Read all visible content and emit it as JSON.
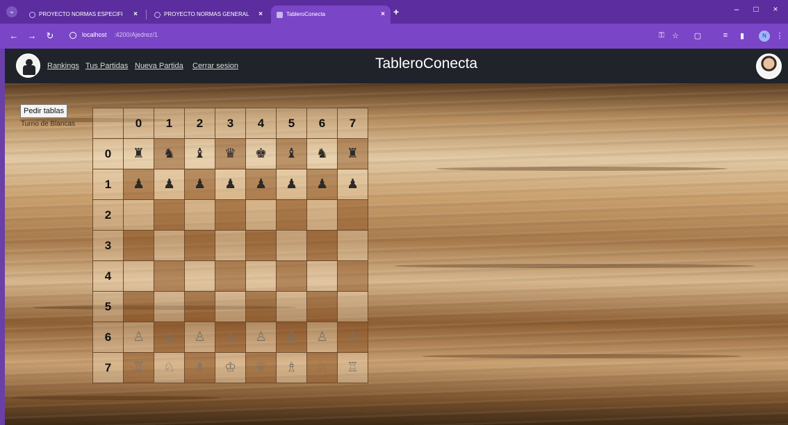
{
  "browser": {
    "tabs": [
      {
        "title": "PROYECTO NORMAS ESPECIFI",
        "active": false
      },
      {
        "title": "PROYECTO NORMAS GENERAL",
        "active": false
      },
      {
        "title": "TableroConecta",
        "active": true
      }
    ],
    "url_host": "localhost",
    "url_path": ":4200/Ajedrez/1",
    "accent_color": "#7b45c7"
  },
  "header": {
    "nav": [
      "Rankings",
      "Tus Partidas",
      "Nueva Partida",
      "Cerrar sesion"
    ],
    "brand": "TableroConecta",
    "background": "#21232a"
  },
  "game": {
    "request_button": "Pedir tablas",
    "turn": "Turno de Blancas",
    "columns": [
      "0",
      "1",
      "2",
      "3",
      "4",
      "5",
      "6",
      "7"
    ],
    "rows": [
      "0",
      "1",
      "2",
      "3",
      "4",
      "5",
      "6",
      "7"
    ],
    "pieces": [
      [
        [
          "black",
          "rook"
        ],
        [
          "black",
          "knight"
        ],
        [
          "black",
          "bishop"
        ],
        [
          "black",
          "queen"
        ],
        [
          "black",
          "king"
        ],
        [
          "black",
          "bishop"
        ],
        [
          "black",
          "knight"
        ],
        [
          "black",
          "rook"
        ]
      ],
      [
        [
          "black",
          "pawn"
        ],
        [
          "black",
          "pawn"
        ],
        [
          "black",
          "pawn"
        ],
        [
          "black",
          "pawn"
        ],
        [
          "black",
          "pawn"
        ],
        [
          "black",
          "pawn"
        ],
        [
          "black",
          "pawn"
        ],
        [
          "black",
          "pawn"
        ]
      ],
      [
        null,
        null,
        null,
        null,
        null,
        null,
        null,
        null
      ],
      [
        null,
        null,
        null,
        null,
        null,
        null,
        null,
        null
      ],
      [
        null,
        null,
        null,
        null,
        null,
        null,
        null,
        null
      ],
      [
        null,
        null,
        null,
        null,
        null,
        null,
        null,
        null
      ],
      [
        [
          "white",
          "pawn"
        ],
        [
          "white",
          "pawn"
        ],
        [
          "white",
          "pawn"
        ],
        [
          "white",
          "pawn"
        ],
        [
          "white",
          "pawn"
        ],
        [
          "white",
          "pawn"
        ],
        [
          "white",
          "pawn"
        ],
        [
          "white",
          "pawn"
        ]
      ],
      [
        [
          "white",
          "rook"
        ],
        [
          "white",
          "knight"
        ],
        [
          "white",
          "bishop"
        ],
        [
          "white",
          "king"
        ],
        [
          "white",
          "queen"
        ],
        [
          "white",
          "bishop"
        ],
        [
          "white",
          "knight"
        ],
        [
          "white",
          "rook"
        ]
      ]
    ]
  }
}
